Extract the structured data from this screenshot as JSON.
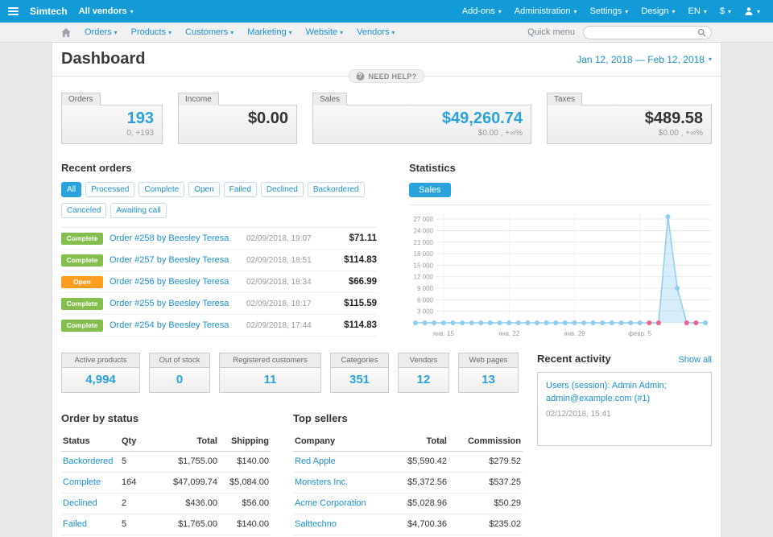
{
  "colors": {
    "topbar": "#129bd7",
    "accent": "#2aa3dc",
    "link": "#1e8fc9",
    "green": "#84bf4e",
    "orange": "#ff9d20",
    "dot": "#8fcdef",
    "dot_highlight": "#f2608e"
  },
  "topbar": {
    "brand": "Simtech",
    "vendor_selector": "All vendors",
    "menus": [
      "Add-ons",
      "Administration",
      "Settings",
      "Design",
      "EN",
      "$"
    ]
  },
  "nav": {
    "items": [
      "Orders",
      "Products",
      "Customers",
      "Marketing",
      "Website",
      "Vendors"
    ],
    "quick_menu": "Quick menu"
  },
  "header": {
    "title": "Dashboard",
    "date_range": "Jan 12, 2018 — Feb 12, 2018",
    "need_help": "NEED HELP?"
  },
  "stat_cards": [
    {
      "label": "Orders",
      "value": "193",
      "sub": "0, +193"
    },
    {
      "label": "Income",
      "value": "$0.00",
      "sub": ""
    },
    {
      "label": "Sales",
      "value": "$49,260.74",
      "sub": "$0.00 , +∞%"
    },
    {
      "label": "Taxes",
      "value": "$489.58",
      "sub": "$0.00 , +∞%"
    }
  ],
  "recent_orders": {
    "title": "Recent orders",
    "filters": [
      "All",
      "Processed",
      "Complete",
      "Open",
      "Failed",
      "Declined",
      "Backordered",
      "Canceled",
      "Awaiting call"
    ],
    "active_filter": "All",
    "status_colors": {
      "Complete": "#84bf4e",
      "Open": "#ff9d20"
    },
    "rows": [
      {
        "status": "Complete",
        "link": "Order #258 by Beesley Teresa",
        "date": "02/09/2018, 19:07",
        "total": "$71.11"
      },
      {
        "status": "Complete",
        "link": "Order #257 by Beesley Teresa",
        "date": "02/09/2018, 18:51",
        "total": "$114.83"
      },
      {
        "status": "Open",
        "link": "Order #256 by Beesley Teresa",
        "date": "02/09/2018, 18:34",
        "total": "$66.99"
      },
      {
        "status": "Complete",
        "link": "Order #255 by Beesley Teresa",
        "date": "02/09/2018, 18:17",
        "total": "$115.59"
      },
      {
        "status": "Complete",
        "link": "Order #254 by Beesley Teresa",
        "date": "02/09/2018, 17:44",
        "total": "$114.83"
      }
    ]
  },
  "statistics": {
    "title": "Statistics",
    "tab": "Sales",
    "chart_data": {
      "type": "line",
      "title": "Sales",
      "x_range": "Jan 12, 2018 — Feb 12, 2018",
      "values": [
        0,
        0,
        0,
        0,
        0,
        0,
        0,
        0,
        0,
        0,
        0,
        0,
        0,
        0,
        0,
        0,
        0,
        0,
        0,
        0,
        0,
        0,
        0,
        0,
        0,
        0,
        0,
        27600,
        9000,
        0,
        0,
        0
      ],
      "ylim": [
        0,
        28500
      ],
      "grid": true,
      "yticks": [
        {
          "v": 3000,
          "label": "3 000"
        },
        {
          "v": 6000,
          "label": "6 000"
        },
        {
          "v": 9000,
          "label": "9 000"
        },
        {
          "v": 12000,
          "label": "12 000"
        },
        {
          "v": 15000,
          "label": "15 000"
        },
        {
          "v": 18000,
          "label": "18 000"
        },
        {
          "v": 21000,
          "label": "21 000"
        },
        {
          "v": 24000,
          "label": "24 000"
        },
        {
          "v": 27000,
          "label": "27 000"
        }
      ],
      "xticks": [
        {
          "i": 3,
          "label": "янв. 15"
        },
        {
          "i": 10,
          "label": "янв. 22"
        },
        {
          "i": 17,
          "label": "янв. 29"
        },
        {
          "i": 24,
          "label": "февр. 5"
        }
      ],
      "highlight_indices": [
        25,
        26,
        29,
        30
      ]
    }
  },
  "summary_cards": [
    {
      "label": "Active products",
      "value": "4,994"
    },
    {
      "label": "Out of stock",
      "value": "0"
    },
    {
      "label": "Registered customers",
      "value": "11"
    },
    {
      "label": "Categories",
      "value": "351"
    },
    {
      "label": "Vendors",
      "value": "12"
    },
    {
      "label": "Web pages",
      "value": "13"
    }
  ],
  "recent_activity": {
    "title": "Recent activity",
    "show_all": "Show all",
    "entries": [
      {
        "text": "Users (session): Admin Admin; admin@example.com (#1)",
        "time": "02/12/2018, 15:41"
      }
    ]
  },
  "order_by_status": {
    "title": "Order by status",
    "headers": [
      "Status",
      "Qty",
      "Total",
      "Shipping"
    ],
    "rows": [
      [
        "Backordered",
        "5",
        "$1,755.00",
        "$140.00"
      ],
      [
        "Complete",
        "164",
        "$47,099.74",
        "$5,084.00"
      ],
      [
        "Declined",
        "2",
        "$436.00",
        "$56.00"
      ],
      [
        "Failed",
        "5",
        "$1,765.00",
        "$140.00"
      ]
    ]
  },
  "top_sellers": {
    "title": "Top sellers",
    "headers": [
      "Company",
      "Total",
      "Commission"
    ],
    "rows": [
      [
        "Red Apple",
        "$5,590.42",
        "$279.52"
      ],
      [
        "Monsters Inc.",
        "$5,372.56",
        "$537.25"
      ],
      [
        "Acme Corporation",
        "$5,028.96",
        "$50.29"
      ],
      [
        "Salttechno",
        "$4,700.36",
        "$235.02"
      ]
    ]
  }
}
